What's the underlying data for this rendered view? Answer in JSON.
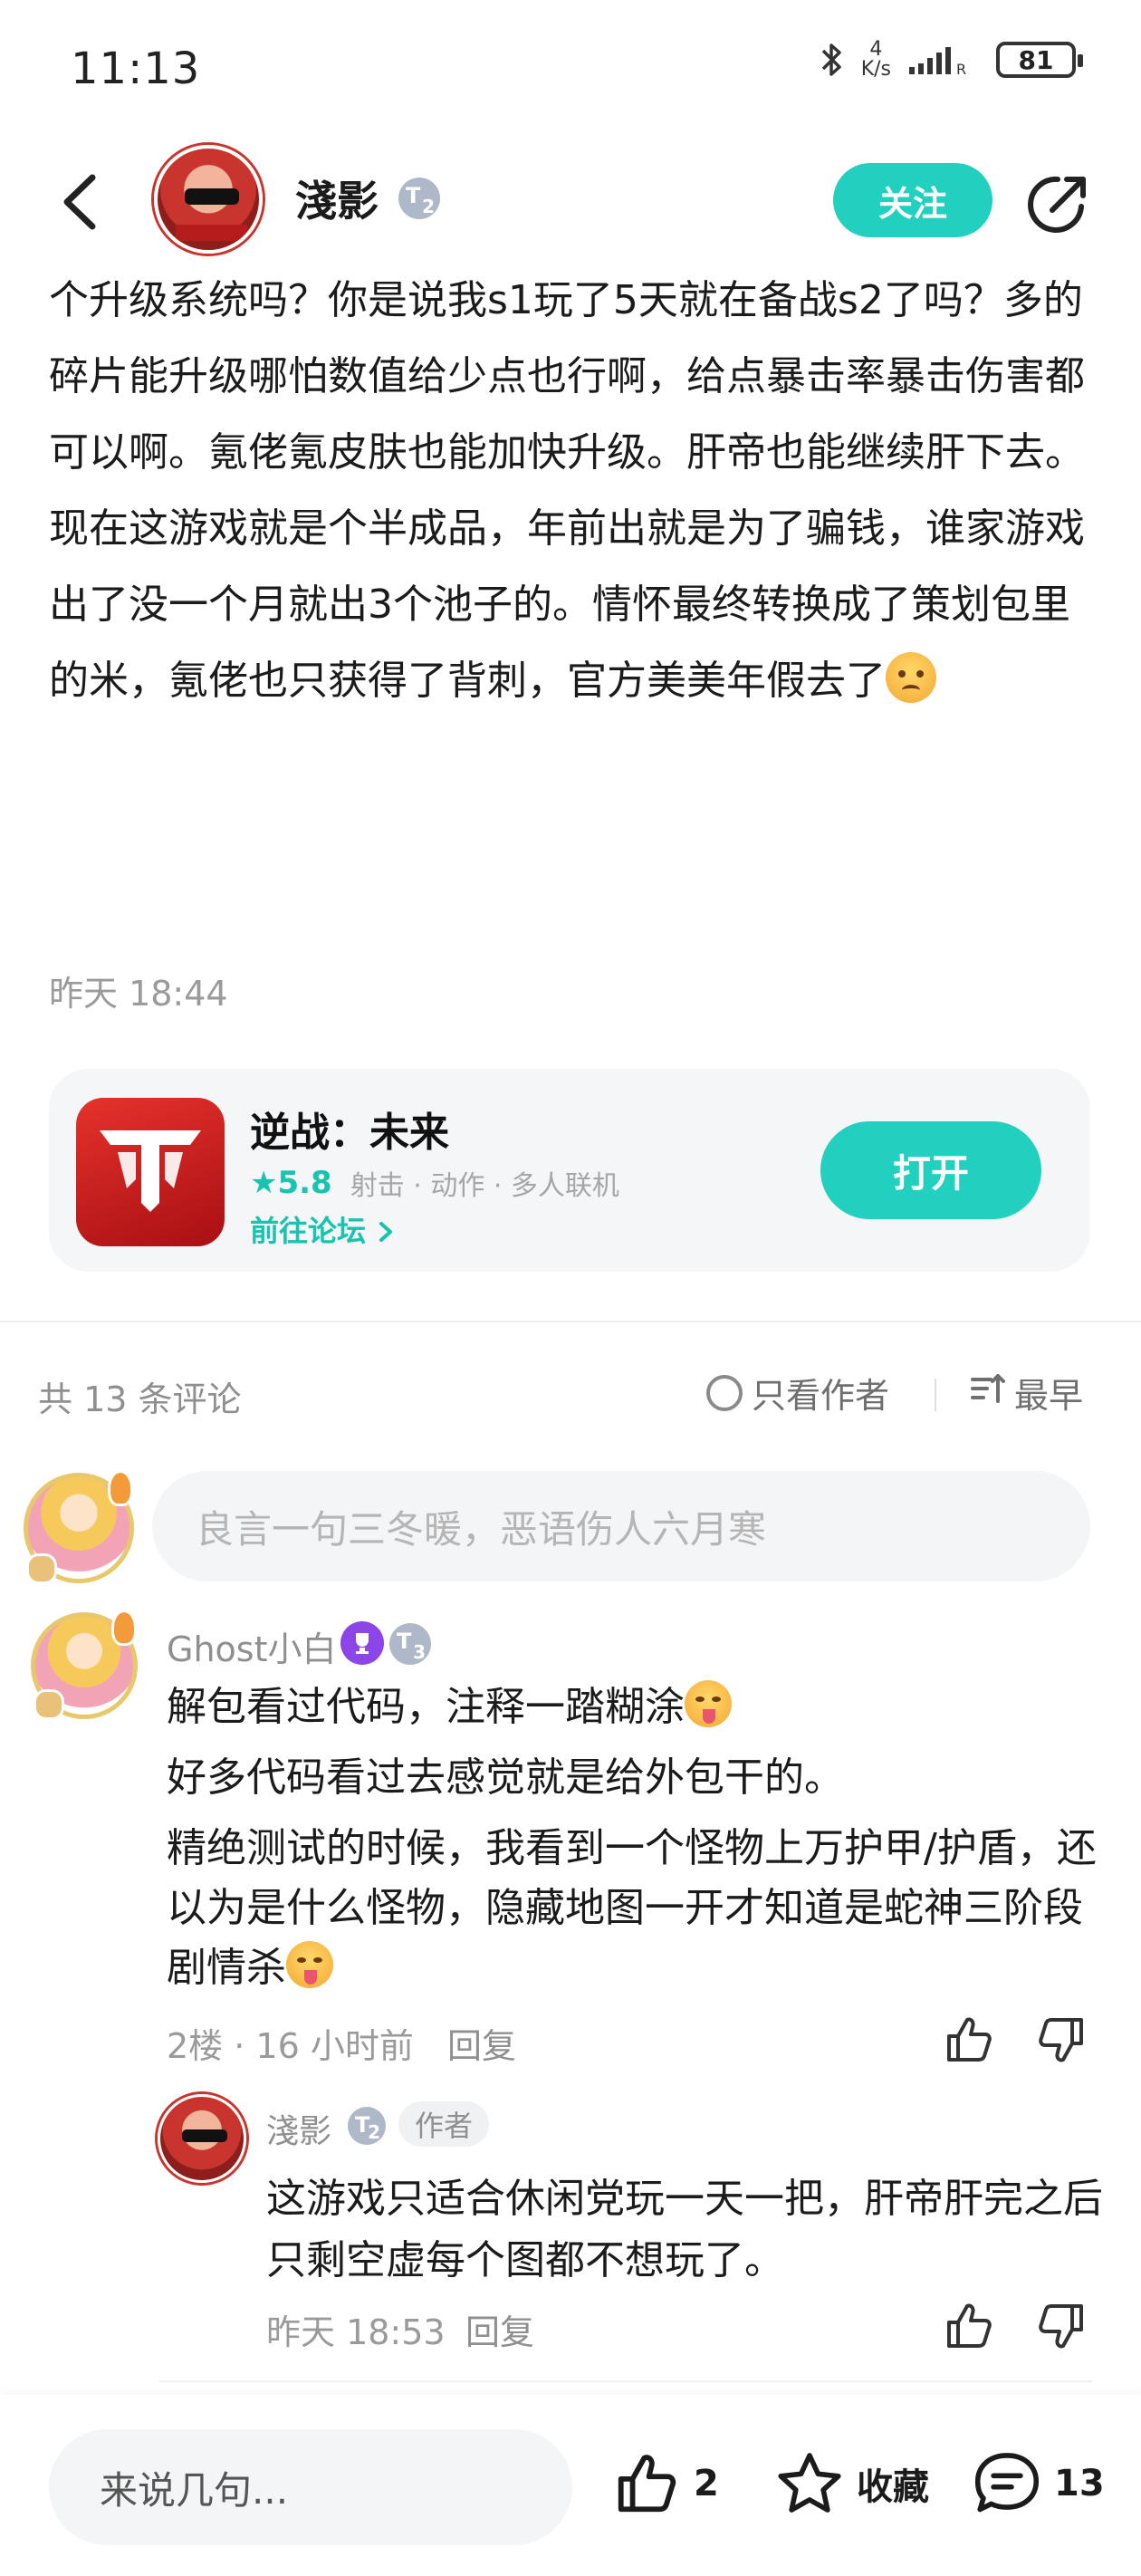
{
  "status_bar": {
    "time": "11:13",
    "net_speed_value": "4",
    "net_speed_unit": "K/s",
    "battery": "81"
  },
  "header": {
    "author_name": "淺影",
    "author_level": "2",
    "follow_label": "关注"
  },
  "post": {
    "paragraphs": [
      "个升级系统吗？你是说我s1玩了5天就在备战s2了吗？多的碎片能升级哪怕数值给少点也行啊，给点暴击率暴击伤害都可以啊。氪佬氪皮肤也能加快升级。肝帝也能继续肝下去。",
      "现在这游戏就是个半成品，年前出就是为了骗钱，谁家游戏出了没一个月就出3个池子的。情怀最终转换成了策划包里的米，氪佬也只获得了背刺，官方美美年假去了"
    ],
    "time": "昨天 18:44"
  },
  "game_card": {
    "title": "逆战：未来",
    "rating": "5.8",
    "tags": "射击 · 动作 · 多人联机",
    "forum_link": "前往论坛",
    "open_label": "打开"
  },
  "comments_header": {
    "count_text": "共 13 条评论",
    "only_author_label": "只看作者",
    "sort_label": "最早"
  },
  "comment_input": {
    "placeholder": "良言一句三冬暖，恶语伤人六月寒"
  },
  "comment1": {
    "username": "Ghost小白",
    "level": "3",
    "lines": [
      "解包看过代码，注释一踏糊涂",
      "好多代码看过去感觉就是给外包干的。",
      "精绝测试的时候，我看到一个怪物上万护甲/护盾，还以为是什么怪物，隐藏地图一开才知道是蛇神三阶段剧情杀"
    ],
    "meta": "2楼 · 16 小时前",
    "reply_label": "回复"
  },
  "reply1": {
    "username": "淺影",
    "level": "2",
    "author_tag": "作者",
    "text": "这游戏只适合休闲党玩一天一把，肝帝肝完之后只剩空虚每个图都不想玩了。",
    "time": "昨天 18:53",
    "reply_label": "回复"
  },
  "bottom_bar": {
    "input_placeholder": "来说几句...",
    "like_count": "2",
    "favorite_label": "收藏",
    "comment_count": "13"
  },
  "colors": {
    "accent": "#21d0be",
    "muted_text": "#9a9a9a",
    "rank_purple": "#8c45e6"
  },
  "icons": [
    "back-icon",
    "share-icon",
    "bluetooth-icon",
    "signal-icon",
    "battery-icon",
    "star-icon",
    "chevron-right-icon",
    "radio-icon",
    "sort-icon",
    "thumb-up-icon",
    "thumb-down-icon",
    "favorite-star-icon",
    "comment-bubble-icon"
  ]
}
